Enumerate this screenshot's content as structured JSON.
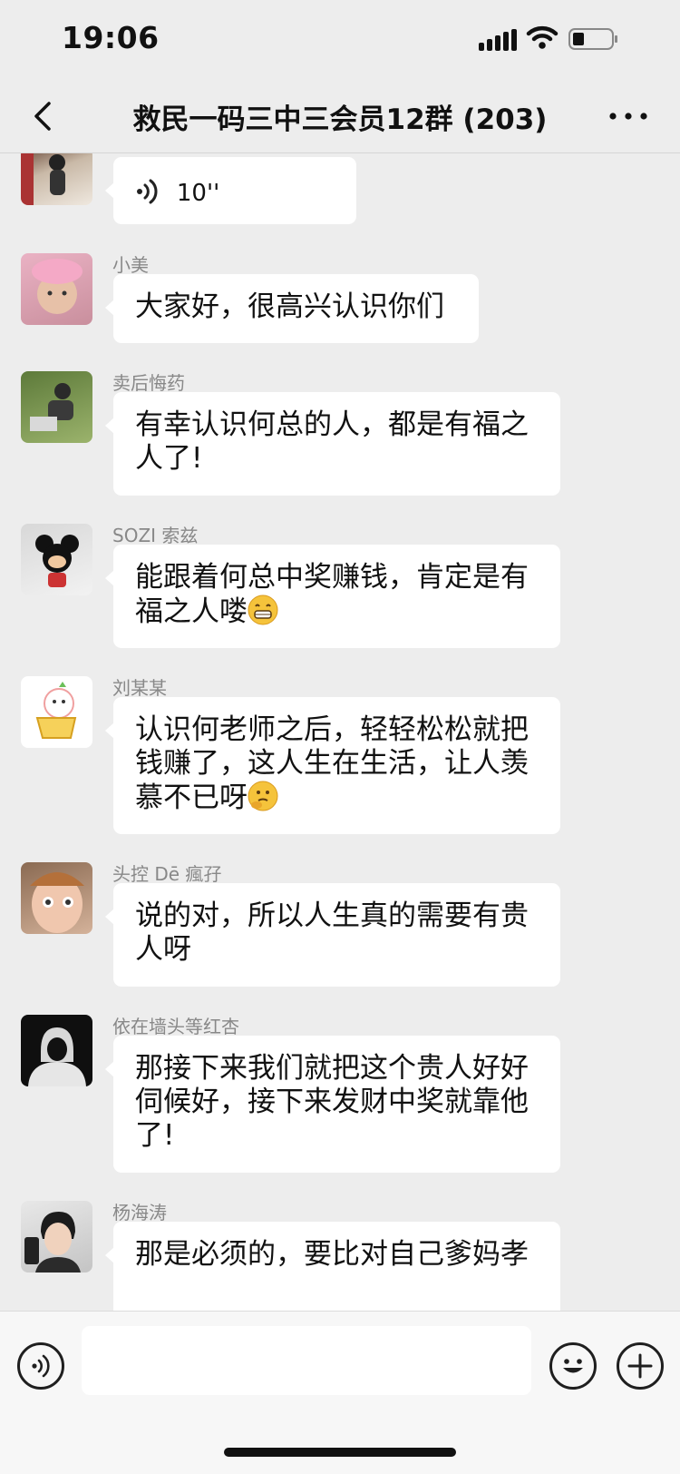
{
  "status_bar": {
    "time": "19:06"
  },
  "header": {
    "title": "救民一码三中三会员12群 (203)"
  },
  "messages": [
    {
      "type": "voice",
      "duration": "10''"
    },
    {
      "sender": "小美",
      "lines": [
        "大家好，很高兴认识你们"
      ]
    },
    {
      "sender": "卖后悔药",
      "lines": [
        "有幸认识何总的人，都是有福之",
        "人了!"
      ]
    },
    {
      "sender": "SOZI 索兹",
      "lines": [
        "能跟着何总中奖赚钱，肯定是有",
        "福之人喽"
      ],
      "emoji": "grin-emoji"
    },
    {
      "sender": "刘某某",
      "lines": [
        "认识何老师之后，轻轻松松就把",
        "钱赚了，这人生在生活，让人羡",
        "慕不已呀"
      ],
      "emoji": "thinking-emoji"
    },
    {
      "sender": "头控 Dē 瘋孖",
      "lines": [
        "说的对，所以人生真的需要有贵",
        "人呀"
      ]
    },
    {
      "sender": "依在墙头等红杏",
      "lines": [
        "那接下来我们就把这个贵人好好",
        "伺候好，接下来发财中奖就靠他",
        "了!"
      ]
    },
    {
      "sender": "杨海涛",
      "lines": [
        "那是必须的，要比对自己爹妈孝"
      ]
    }
  ],
  "input": {
    "value": ""
  },
  "colors": {
    "background": "#ededed",
    "bubble": "#ffffff",
    "sender_text": "#888888"
  }
}
